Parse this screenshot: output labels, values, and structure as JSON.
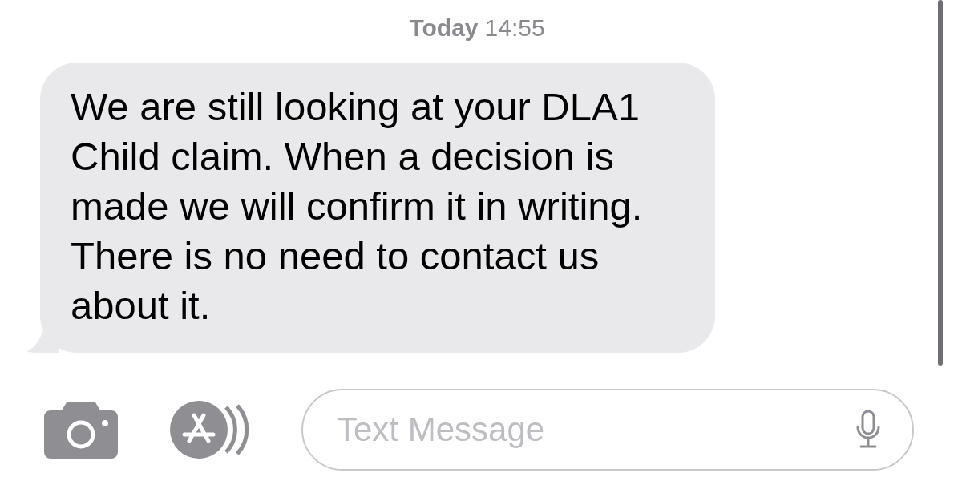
{
  "timestamp": {
    "day": "Today",
    "time": "14:55"
  },
  "messages": [
    {
      "text": "We are still looking at your DLA1 Child claim. When a decision is made we will confirm it in writing. There is no need to contact us about it."
    }
  ],
  "composer": {
    "placeholder": "Text Message"
  }
}
